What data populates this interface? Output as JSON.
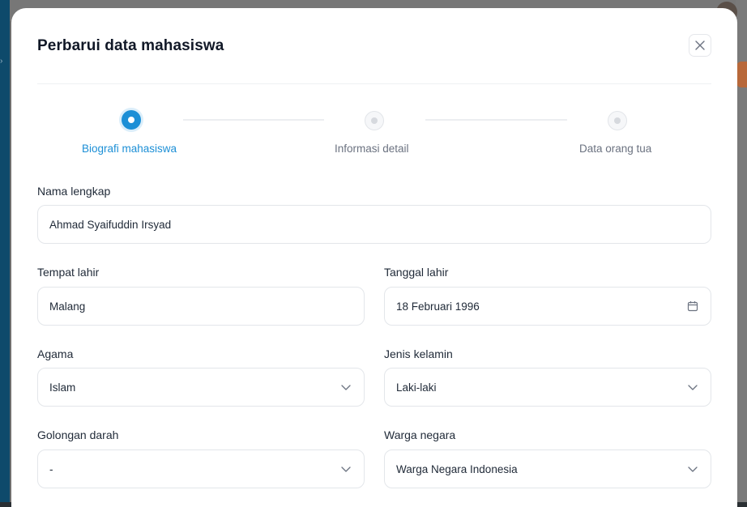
{
  "modal": {
    "title": "Perbarui data mahasiswa"
  },
  "stepper": {
    "steps": [
      {
        "label": "Biografi mahasiswa",
        "state": "active"
      },
      {
        "label": "Informasi detail",
        "state": "inactive"
      },
      {
        "label": "Data orang tua",
        "state": "inactive"
      }
    ]
  },
  "form": {
    "full_name": {
      "label": "Nama lengkap",
      "value": "Ahmad Syaifuddin Irsyad"
    },
    "birth_place": {
      "label": "Tempat lahir",
      "value": "Malang"
    },
    "birth_date": {
      "label": "Tanggal lahir",
      "value": "18 Februari 1996",
      "icon": "calendar-icon"
    },
    "religion": {
      "label": "Agama",
      "value": "Islam",
      "icon": "chevron-down-icon"
    },
    "gender": {
      "label": "Jenis kelamin",
      "value": "Laki-laki",
      "icon": "chevron-down-icon"
    },
    "blood_type": {
      "label": "Golongan darah",
      "value": "-",
      "icon": "chevron-down-icon"
    },
    "citizenship": {
      "label": "Warga negara",
      "value": "Warga Negara Indonesia",
      "icon": "chevron-down-icon"
    }
  },
  "colors": {
    "accent": "#1c8fd6",
    "sidebar": "#0e4a6b"
  }
}
